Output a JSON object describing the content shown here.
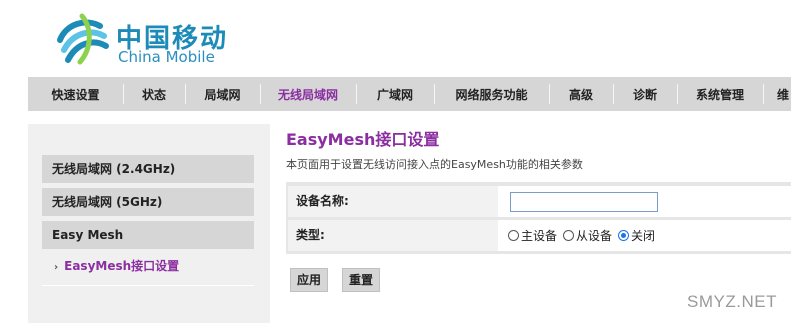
{
  "logo": {
    "cn": "中国移动",
    "en": "China Mobile",
    "icon": "china-mobile-logo"
  },
  "nav": {
    "items": [
      {
        "label": "快速设置"
      },
      {
        "label": "状态"
      },
      {
        "label": "局域网"
      },
      {
        "label": "无线局域网",
        "active": true
      },
      {
        "label": "广域网"
      },
      {
        "label": "网络服务功能"
      },
      {
        "label": "高级"
      },
      {
        "label": "诊断"
      },
      {
        "label": "系统管理"
      },
      {
        "label": "维"
      }
    ]
  },
  "sidebar": {
    "items": [
      {
        "label": "无线局域网 (2.4GHz)"
      },
      {
        "label": "无线局域网 (5GHz)"
      },
      {
        "label": "Easy Mesh"
      }
    ],
    "sub_items": [
      {
        "label": "EasyMesh接口设置",
        "active": true
      }
    ]
  },
  "main": {
    "title": "EasyMesh接口设置",
    "description": "本页面用于设置无线访问接入点的EasyMesh功能的相关参数",
    "form": {
      "device_name": {
        "label": "设备名称:",
        "value": ""
      },
      "type": {
        "label": "类型:",
        "options": [
          "主设备",
          "从设备",
          "关闭"
        ],
        "selected": "关闭"
      }
    },
    "buttons": {
      "apply": "应用",
      "reset": "重置"
    }
  },
  "watermark": "SMYZ.NET",
  "colors": {
    "accent": "#8b2ea0",
    "nav_bg": "#d6d6d6",
    "logo_blue": "#1c8bb8"
  }
}
